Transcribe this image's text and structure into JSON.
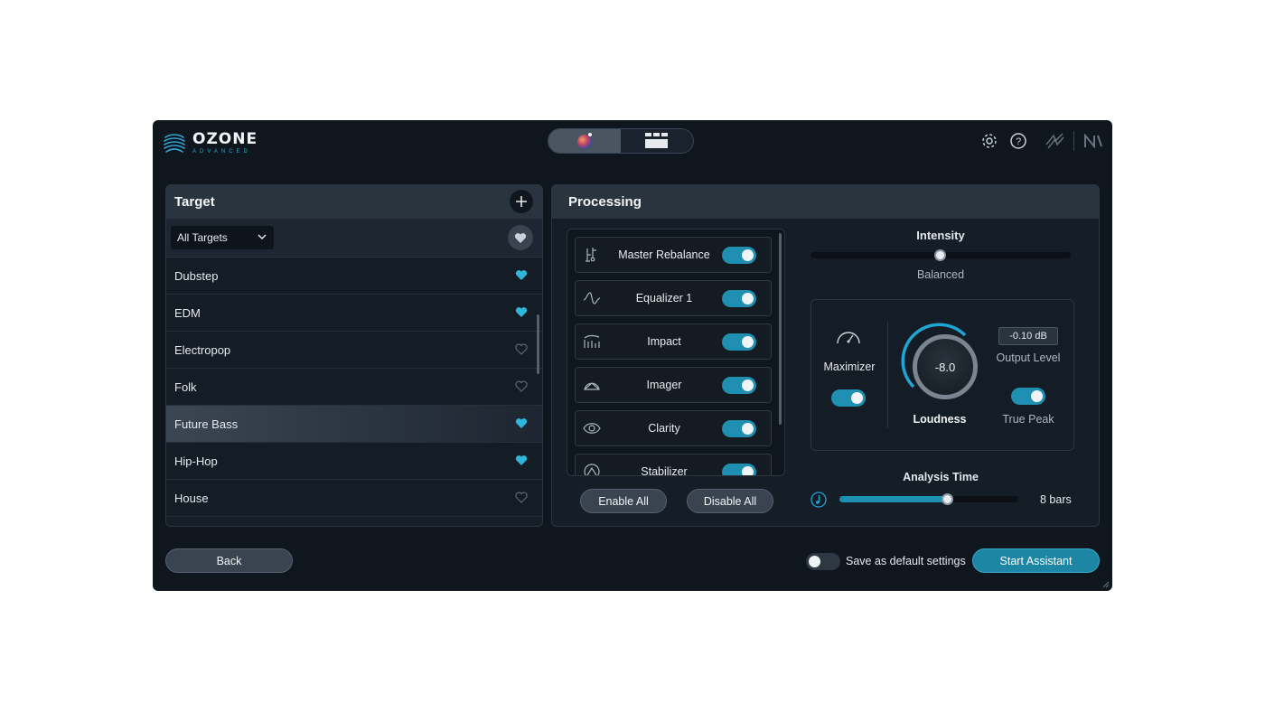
{
  "app": {
    "brand": "OZONE",
    "brand_sub": "ADVANCED"
  },
  "target_panel": {
    "title": "Target",
    "filter_value": "All Targets",
    "items": [
      {
        "label": "Dubstep",
        "favorite": true
      },
      {
        "label": "EDM",
        "favorite": true
      },
      {
        "label": "Electropop",
        "favorite": false
      },
      {
        "label": "Folk",
        "favorite": false
      },
      {
        "label": "Future Bass",
        "favorite": true,
        "selected": true
      },
      {
        "label": "Hip-Hop",
        "favorite": true
      },
      {
        "label": "House",
        "favorite": false
      }
    ]
  },
  "processing": {
    "title": "Processing",
    "modules": [
      {
        "label": "Master Rebalance",
        "enabled": true
      },
      {
        "label": "Equalizer 1",
        "enabled": true
      },
      {
        "label": "Impact",
        "enabled": true
      },
      {
        "label": "Imager",
        "enabled": true
      },
      {
        "label": "Clarity",
        "enabled": true
      },
      {
        "label": "Stabilizer",
        "enabled": true
      }
    ],
    "enable_all": "Enable All",
    "disable_all": "Disable All",
    "intensity": {
      "label": "Intensity",
      "value_label": "Balanced",
      "value": 0.5
    },
    "maximizer": {
      "label": "Maximizer",
      "enabled": true
    },
    "loudness": {
      "label": "Loudness",
      "value": "-8.0"
    },
    "output_level": {
      "value": "-0.10 dB",
      "label": "Output Level"
    },
    "true_peak": {
      "label": "True Peak",
      "enabled": true
    },
    "analysis_time": {
      "label": "Analysis Time",
      "value_label": "8 bars",
      "value": 0.6
    }
  },
  "footer": {
    "back": "Back",
    "save_default": "Save as default settings",
    "save_default_on": false,
    "start": "Start Assistant"
  },
  "colors": {
    "accent": "#1f8fb2",
    "favorite": "#2fb6da"
  }
}
